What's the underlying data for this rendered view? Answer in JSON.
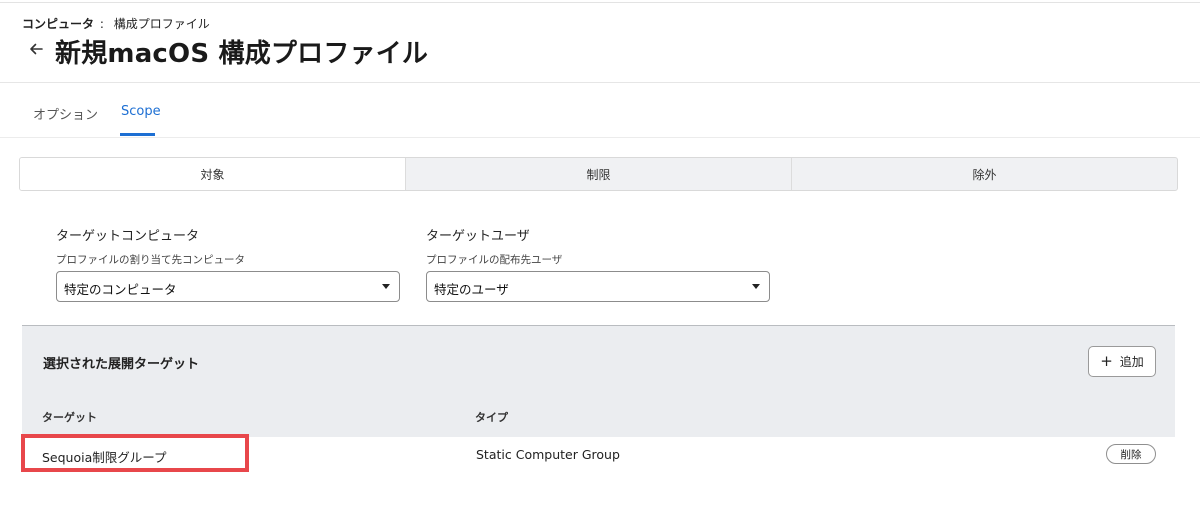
{
  "breadcrumb": {
    "root": "コンピュータ",
    "separator": ":",
    "current": "構成プロファイル"
  },
  "header": {
    "title": "新規macOS 構成プロファイル",
    "back_icon": "arrow-left-icon"
  },
  "tabs": [
    {
      "label": "オプション",
      "active": false
    },
    {
      "label": "Scope",
      "active": true
    }
  ],
  "accent_color": "#1d6fd3",
  "scope_segments": [
    {
      "label": "対象",
      "active": true
    },
    {
      "label": "制限",
      "active": false
    },
    {
      "label": "除外",
      "active": false
    }
  ],
  "target_computers": {
    "label": "ターゲットコンピュータ",
    "sublabel": "プロファイルの割り当て先コンピュータ",
    "selected": "特定のコンピュータ"
  },
  "target_users": {
    "label": "ターゲットユーザ",
    "sublabel": "プロファイルの配布先ユーザ",
    "selected": "特定のユーザ"
  },
  "deployment_targets": {
    "title": "選択された展開ターゲット",
    "add_label": "追加",
    "columns": {
      "target": "ターゲット",
      "type": "タイプ"
    },
    "rows": [
      {
        "name": "Sequoia制限グループ",
        "type": "Static Computer Group",
        "delete_label": "削除"
      }
    ]
  },
  "highlight_color": "#e8474b"
}
